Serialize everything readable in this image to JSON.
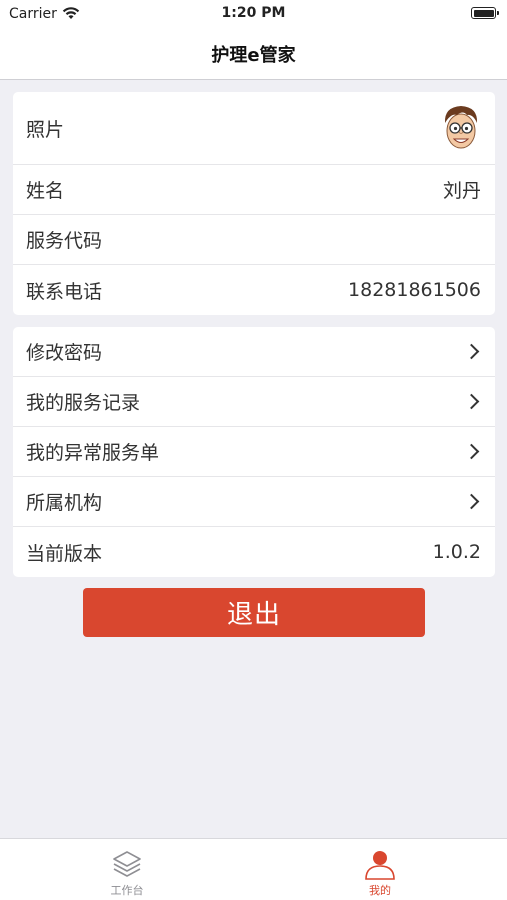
{
  "status_bar": {
    "carrier": "Carrier",
    "time": "1:20 PM"
  },
  "nav": {
    "title": "护理e管家"
  },
  "profile": {
    "photo_label": "照片",
    "name_label": "姓名",
    "name_value": "刘丹",
    "service_code_label": "服务代码",
    "service_code_value": "",
    "phone_label": "联系电话",
    "phone_value": "18281861506"
  },
  "menu": {
    "change_password": "修改密码",
    "service_records": "我的服务记录",
    "abnormal_orders": "我的异常服务单",
    "organization": "所属机构",
    "version_label": "当前版本",
    "version_value": "1.0.2"
  },
  "logout_label": "退出",
  "tabs": [
    {
      "label": "工作台",
      "icon": "layers-icon",
      "active": false
    },
    {
      "label": "我的",
      "icon": "person-icon",
      "active": true
    }
  ],
  "colors": {
    "accent": "#d9472f",
    "background": "#efeff4",
    "inactive_tab": "#8e8e93"
  }
}
